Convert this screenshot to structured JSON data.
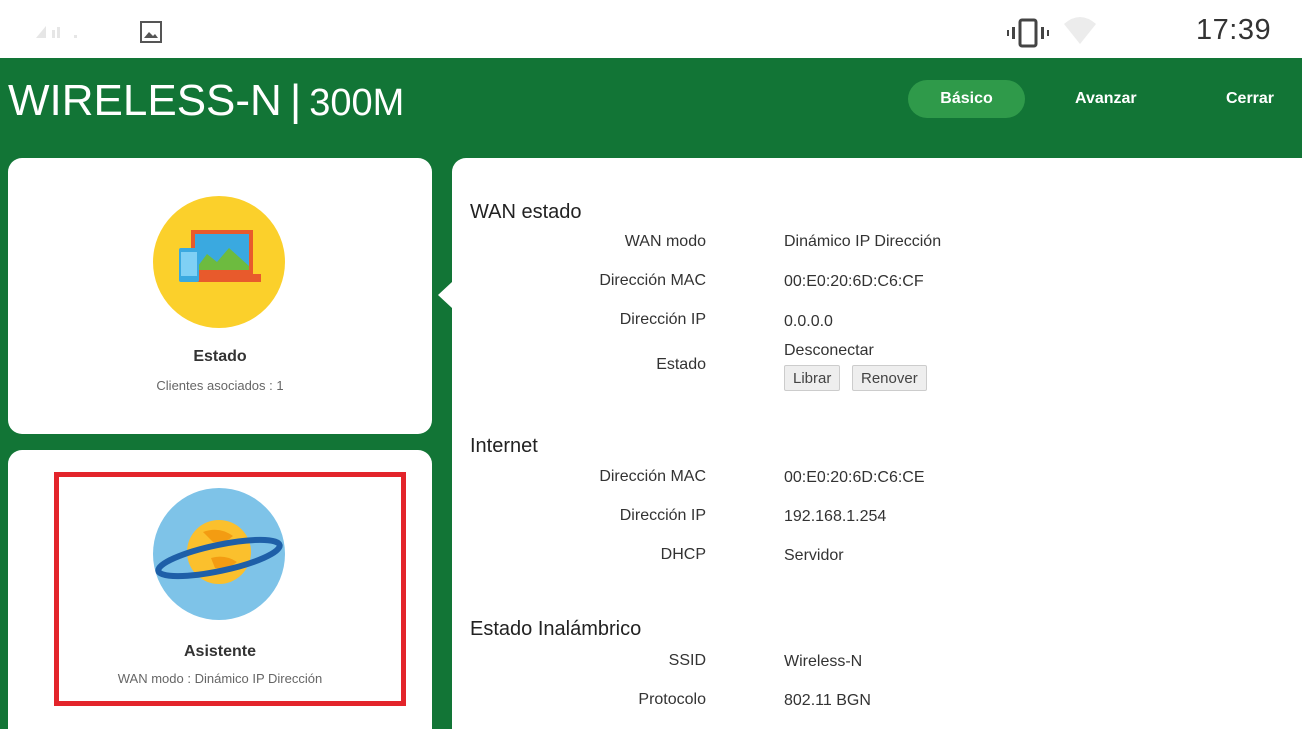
{
  "status_bar": {
    "time": "17:39",
    "icons": [
      "signal-icon",
      "image-icon",
      "vibrate-icon",
      "wifi-icon"
    ]
  },
  "header": {
    "brand_main": "WIRELESS-N",
    "brand_sep": "|",
    "brand_speed": "300M",
    "nav": {
      "basic": "Básico",
      "advanced": "Avanzar",
      "close": "Cerrar"
    }
  },
  "cards": {
    "status": {
      "title": "Estado",
      "subtitle": "Clientes asociados : 1",
      "icon": "laptop-icon"
    },
    "wizard": {
      "title": "Asistente",
      "subtitle": "WAN modo : Dinámico IP Dirección",
      "icon": "planet-icon"
    }
  },
  "wan": {
    "title": "WAN estado",
    "mode_label": "WAN modo",
    "mode_value": "Dinámico IP Dirección",
    "mac_label": "Dirección MAC",
    "mac_value": "00:E0:20:6D:C6:CF",
    "ip_label": "Dirección IP",
    "ip_value": "0.0.0.0",
    "state_label": "Estado",
    "state_value": "Desconectar",
    "release_button": "Librar",
    "renew_button": "Renover"
  },
  "internet": {
    "title": "Internet",
    "mac_label": "Dirección MAC",
    "mac_value": "00:E0:20:6D:C6:CE",
    "ip_label": "Dirección IP",
    "ip_value": "192.168.1.254",
    "dhcp_label": "DHCP",
    "dhcp_value": "Servidor"
  },
  "wireless": {
    "title": "Estado Inalámbrico",
    "ssid_label": "SSID",
    "ssid_value": "Wireless-N",
    "protocol_label": "Protocolo",
    "protocol_value": "802.11 BGN"
  },
  "colors": {
    "header_green": "#127536",
    "active_tab": "#2f9a4a",
    "highlight_red": "#e3242b",
    "status_circle": "#fbd02b",
    "wizard_circle": "#7ec3e8"
  }
}
